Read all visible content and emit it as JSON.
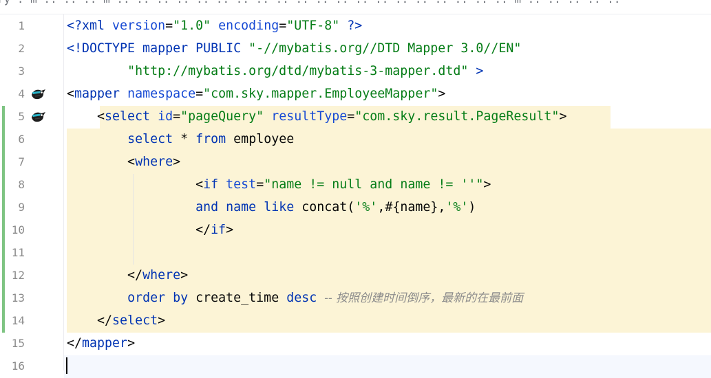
{
  "topbar": {
    "breadcrumbs": "ry   .   m   ..   ..   ..   m   ..   ..   ..   ..   ..   ..   ..   ..   ..   ..   ..   ..   ..   ..   ..   ..   ..   ..   ..   ..   m   ..   ..   ..   ..   .."
  },
  "gutter_icons": [
    "mybatis-bird-icon",
    "mybatis-bird-icon"
  ],
  "lines": [
    {
      "n": "1",
      "t": [
        [
          "tag",
          "<?xml "
        ],
        [
          "attr",
          "version"
        ],
        [
          "txt",
          "="
        ],
        [
          "str",
          "\"1.0\" "
        ],
        [
          "attr",
          "encoding"
        ],
        [
          "txt",
          "="
        ],
        [
          "str",
          "\"UTF-8\" "
        ],
        [
          "tag",
          "?>"
        ]
      ]
    },
    {
      "n": "2",
      "t": [
        [
          "tag",
          "<!DOCTYPE mapper PUBLIC "
        ],
        [
          "str",
          "\"-//mybatis.org//DTD Mapper 3.0//EN\""
        ]
      ]
    },
    {
      "n": "3",
      "t": [
        [
          "txt",
          "        "
        ],
        [
          "str",
          "\"http://mybatis.org/dtd/mybatis-3-mapper.dtd\" "
        ],
        [
          "tag",
          ">"
        ]
      ]
    },
    {
      "n": "4",
      "t": [
        [
          "txt",
          "<"
        ],
        [
          "tag",
          "mapper "
        ],
        [
          "attr",
          "namespace"
        ],
        [
          "txt",
          "="
        ],
        [
          "str",
          "\"com.sky.mapper.EmployeeMapper\""
        ],
        [
          "txt",
          ">"
        ]
      ]
    },
    {
      "n": "5",
      "t": [
        [
          "txt",
          "    <"
        ],
        [
          "tag",
          "select "
        ],
        [
          "attr",
          "id"
        ],
        [
          "txt",
          "="
        ],
        [
          "str",
          "\"pageQuery\" "
        ],
        [
          "attr",
          "resultType"
        ],
        [
          "txt",
          "="
        ],
        [
          "str",
          "\"com.sky.result.PageResult\""
        ],
        [
          "txt",
          ">"
        ]
      ]
    },
    {
      "n": "6",
      "t": [
        [
          "txt",
          "        "
        ],
        [
          "kw",
          "select"
        ],
        [
          "txt",
          " * "
        ],
        [
          "kw",
          "from"
        ],
        [
          "txt",
          " employee"
        ]
      ]
    },
    {
      "n": "7",
      "t": [
        [
          "txt",
          "        <"
        ],
        [
          "tag",
          "where"
        ],
        [
          "txt",
          ">"
        ]
      ]
    },
    {
      "n": "8",
      "t": [
        [
          "txt",
          "                 <"
        ],
        [
          "tag",
          "if "
        ],
        [
          "attr",
          "test"
        ],
        [
          "txt",
          "="
        ],
        [
          "str",
          "\"name != null and name != ''\""
        ],
        [
          "txt",
          ">"
        ]
      ]
    },
    {
      "n": "9",
      "t": [
        [
          "txt",
          "                 "
        ],
        [
          "kw",
          "and"
        ],
        [
          "txt",
          " "
        ],
        [
          "kw",
          "name"
        ],
        [
          "txt",
          " "
        ],
        [
          "kw",
          "like"
        ],
        [
          "txt",
          " concat("
        ],
        [
          "str",
          "'%'"
        ],
        [
          "txt",
          ",#{name},"
        ],
        [
          "str",
          "'%'"
        ],
        [
          "txt",
          ")"
        ]
      ]
    },
    {
      "n": "10",
      "t": [
        [
          "txt",
          "                 </"
        ],
        [
          "tag",
          "if"
        ],
        [
          "txt",
          ">"
        ]
      ]
    },
    {
      "n": "11",
      "t": []
    },
    {
      "n": "12",
      "t": [
        [
          "txt",
          "        </"
        ],
        [
          "tag",
          "where"
        ],
        [
          "txt",
          ">"
        ]
      ]
    },
    {
      "n": "13",
      "t": [
        [
          "txt",
          "        "
        ],
        [
          "kw",
          "order by"
        ],
        [
          "txt",
          " create_time "
        ],
        [
          "kw",
          "desc"
        ],
        [
          "txt",
          " "
        ],
        [
          "cmt",
          "-- 按照创建时间倒序，最新的在最前面"
        ]
      ]
    },
    {
      "n": "14",
      "t": [
        [
          "txt",
          "    </"
        ],
        [
          "tag",
          "select"
        ],
        [
          "txt",
          ">"
        ]
      ]
    },
    {
      "n": "15",
      "t": [
        [
          "txt",
          "</"
        ],
        [
          "tag",
          "mapper"
        ],
        [
          "txt",
          ">"
        ]
      ]
    },
    {
      "n": "16",
      "t": []
    }
  ],
  "colors": {
    "tag": "#0033b3",
    "attribute": "#174ad4",
    "string": "#067d17",
    "highlight": "#fcf4d6",
    "vcs_changed": "#7ec482"
  }
}
